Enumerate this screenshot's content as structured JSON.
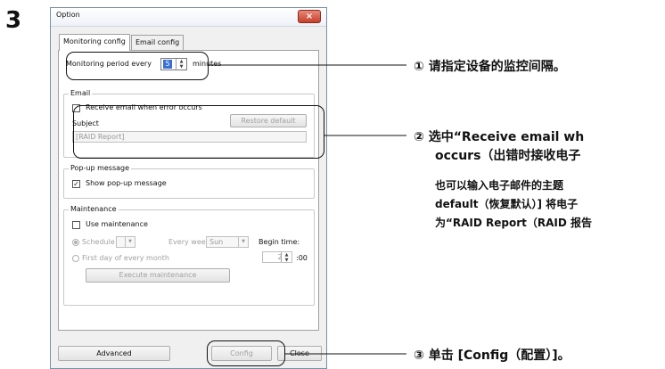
{
  "step": "3",
  "dialog": {
    "title": "Option",
    "close_glyph": "×",
    "tabs": [
      {
        "label": "Monitoring config"
      },
      {
        "label": "Email config"
      }
    ],
    "monitoring": {
      "prefix": "Monitoring period every",
      "value": "5",
      "suffix": "minutes"
    },
    "email": {
      "legend": "Email",
      "receive_label": "Receive email when error occurs",
      "receive_checked": false,
      "subject_label": "Subject",
      "restore_label": "Restore default",
      "subject_value": "[RAID Report]"
    },
    "popup": {
      "legend": "Pop-up message",
      "show_label": "Show pop-up message",
      "check_glyph": "✓"
    },
    "maintenance": {
      "legend": "Maintenance",
      "use_label": "Use maintenance",
      "schedule_label": "Schedule",
      "every_week": "Every week",
      "day_value": "Sun",
      "begin_label": "Begin time:",
      "first_day_label": "First day of every month",
      "hour_value": "2",
      "minutes_suffix": ":00",
      "execute_label": "Execute maintenance"
    },
    "buttons": {
      "advanced": "Advanced",
      "config": "Config",
      "close": "Close"
    }
  },
  "annotations": [
    {
      "text": "① 请指定设备的监控间隔。"
    },
    {
      "text": "② 选中“Receive email wh",
      "line2": "occurs（出错时接收电子"
    },
    {
      "text": "也可以输入电子邮件的主题",
      "line2": "default（恢复默认）] 将电子",
      "line3": "为“RAID Report（RAID 报告"
    },
    {
      "text": "③ 单击 [Config（配置）]。"
    }
  ]
}
